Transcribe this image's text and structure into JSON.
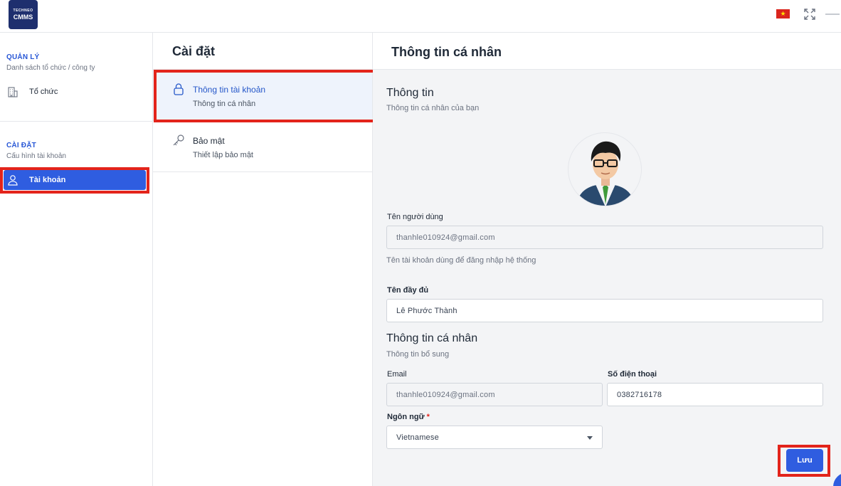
{
  "header": {
    "logo_small": "TECHNEO",
    "logo_big": "CMMS",
    "flag_icon": "vietnam-flag-icon",
    "expand_icon": "fullscreen-icon",
    "minimize_icon": "minimize-icon"
  },
  "sidebar": {
    "sections": [
      {
        "title": "QUẢN LÝ",
        "subtitle": "Danh sách tổ chức / công ty",
        "items": [
          {
            "label": "Tổ chức",
            "icon": "building-icon"
          }
        ]
      },
      {
        "title": "CÀI ĐẶT",
        "subtitle": "Cấu hình tài khoản",
        "items": [
          {
            "label": "Tài khoản",
            "icon": "user-icon",
            "active": true
          }
        ]
      }
    ]
  },
  "settings": {
    "title": "Cài đặt",
    "menu": [
      {
        "label": "Thông tin tài khoản",
        "subtitle": "Thông tin cá nhân",
        "icon": "lock-icon",
        "active": true
      },
      {
        "label": "Bảo mật",
        "subtitle": "Thiết lập bảo mật",
        "icon": "key-icon"
      }
    ]
  },
  "profile": {
    "title": "Thông tin cá nhân",
    "info": {
      "heading": "Thông tin",
      "subheading": "Thông tin cá nhân của bạn"
    },
    "username": {
      "label": "Tên người dùng",
      "value": "thanhle010924@gmail.com",
      "help": "Tên tài khoản dùng để đăng nhập hệ thống"
    },
    "fullname": {
      "label": "Tên đầy đủ",
      "value": "Lê Phước Thành"
    },
    "personal": {
      "heading": "Thông tin cá nhân",
      "subheading": "Thông tin bổ sung"
    },
    "email": {
      "label": "Email",
      "value": "thanhle010924@gmail.com"
    },
    "phone": {
      "label": "Số điện thoại",
      "value": "0382716178"
    },
    "language": {
      "label": "Ngôn ngữ",
      "required_mark": "*",
      "value": "Vietnamese"
    },
    "save_label": "Lưu"
  },
  "colors": {
    "accent": "#2f5de0",
    "highlight": "#e3241b",
    "active_text": "#2557c9"
  }
}
